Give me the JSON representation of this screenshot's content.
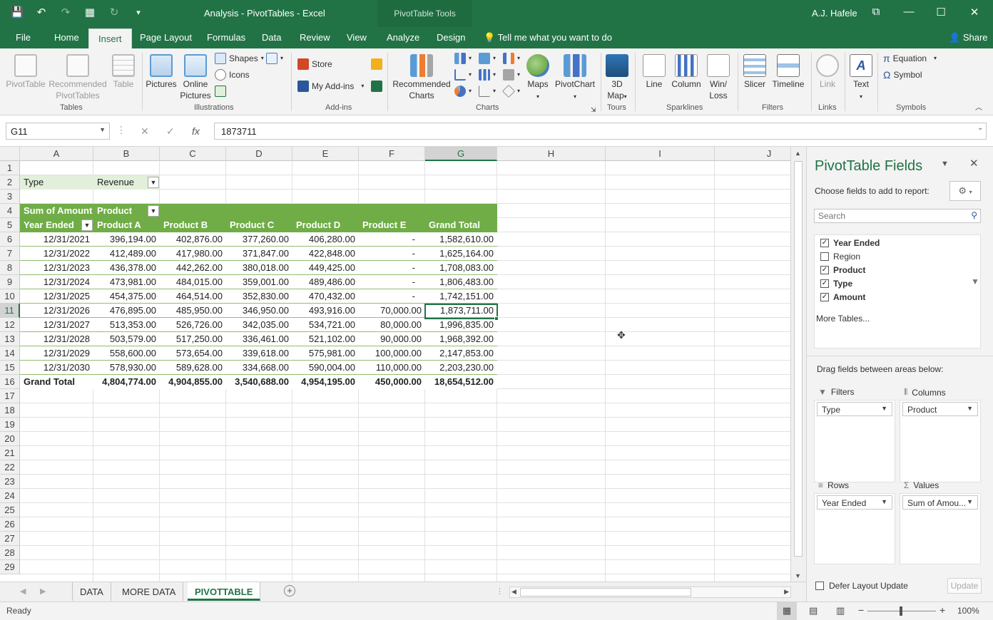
{
  "title": "Analysis - PivotTables  -  Excel",
  "context_tab_group": "PivotTable Tools",
  "user": "A.J. Hafele",
  "tabs": [
    "File",
    "Home",
    "Insert",
    "Page Layout",
    "Formulas",
    "Data",
    "Review",
    "View",
    "Analyze",
    "Design"
  ],
  "tell_me": "Tell me what you want to do",
  "share": "Share",
  "ribbon": {
    "tables": {
      "label": "Tables",
      "pivot": "PivotTable",
      "rec1": "Recommended",
      "rec2": "PivotTables",
      "table": "Table"
    },
    "illustrations": {
      "label": "Illustrations",
      "pictures": "Pictures",
      "online1": "Online",
      "online2": "Pictures",
      "shapes": "Shapes",
      "icons": "Icons"
    },
    "addins": {
      "label": "Add-ins",
      "store": "Store",
      "my": "My Add-ins"
    },
    "charts": {
      "label": "Charts",
      "rec1": "Recommended",
      "rec2": "Charts",
      "maps": "Maps",
      "pivotchart": "PivotChart"
    },
    "tours": {
      "label": "Tours",
      "map1": "3D",
      "map2": "Map"
    },
    "sparklines": {
      "label": "Sparklines",
      "line": "Line",
      "column": "Column",
      "win1": "Win/",
      "win2": "Loss"
    },
    "filters": {
      "label": "Filters",
      "slicer": "Slicer",
      "timeline": "Timeline"
    },
    "links": {
      "label": "Links",
      "link": "Link"
    },
    "text": {
      "text": "Text"
    },
    "symbols": {
      "label": "Symbols",
      "equation": "Equation",
      "symbol": "Symbol"
    }
  },
  "namebox": "G11",
  "formula": "1873711",
  "columns": [
    {
      "l": "A",
      "w": 103
    },
    {
      "l": "B",
      "w": 93
    },
    {
      "l": "C",
      "w": 93
    },
    {
      "l": "D",
      "w": 93
    },
    {
      "l": "E",
      "w": 93
    },
    {
      "l": "F",
      "w": 93
    },
    {
      "l": "G",
      "w": 101
    },
    {
      "l": "H",
      "w": 152
    },
    {
      "l": "I",
      "w": 153
    },
    {
      "l": "J",
      "w": 153
    }
  ],
  "rows": [
    "1",
    "2",
    "3",
    "4",
    "5",
    "6",
    "7",
    "8",
    "9",
    "10",
    "11",
    "12",
    "13",
    "14",
    "15",
    "16",
    "17",
    "18",
    "19",
    "20",
    "21",
    "22",
    "23",
    "24",
    "25",
    "26",
    "27",
    "28",
    "29"
  ],
  "pivot": {
    "filter_label": "Type",
    "filter_value": "Revenue",
    "corner": "Sum of Amount",
    "col_field": "Product",
    "row_field": "Year Ended",
    "col_headers": [
      "Product A",
      "Product B",
      "Product C",
      "Product D",
      "Product E",
      "Grand Total"
    ],
    "data": [
      [
        "12/31/2021",
        "396,194.00",
        "402,876.00",
        "377,260.00",
        "406,280.00",
        "-",
        "1,582,610.00"
      ],
      [
        "12/31/2022",
        "412,489.00",
        "417,980.00",
        "371,847.00",
        "422,848.00",
        "-",
        "1,625,164.00"
      ],
      [
        "12/31/2023",
        "436,378.00",
        "442,262.00",
        "380,018.00",
        "449,425.00",
        "-",
        "1,708,083.00"
      ],
      [
        "12/31/2024",
        "473,981.00",
        "484,015.00",
        "359,001.00",
        "489,486.00",
        "-",
        "1,806,483.00"
      ],
      [
        "12/31/2025",
        "454,375.00",
        "464,514.00",
        "352,830.00",
        "470,432.00",
        "-",
        "1,742,151.00"
      ],
      [
        "12/31/2026",
        "476,895.00",
        "485,950.00",
        "346,950.00",
        "493,916.00",
        "70,000.00",
        "1,873,711.00"
      ],
      [
        "12/31/2027",
        "513,353.00",
        "526,726.00",
        "342,035.00",
        "534,721.00",
        "80,000.00",
        "1,996,835.00"
      ],
      [
        "12/31/2028",
        "503,579.00",
        "517,250.00",
        "336,461.00",
        "521,102.00",
        "90,000.00",
        "1,968,392.00"
      ],
      [
        "12/31/2029",
        "558,600.00",
        "573,654.00",
        "339,618.00",
        "575,981.00",
        "100,000.00",
        "2,147,853.00"
      ],
      [
        "12/31/2030",
        "578,930.00",
        "589,628.00",
        "334,668.00",
        "590,004.00",
        "110,000.00",
        "2,203,230.00"
      ]
    ],
    "total": [
      "Grand Total",
      "4,804,774.00",
      "4,904,855.00",
      "3,540,688.00",
      "4,954,195.00",
      "450,000.00",
      "18,654,512.00"
    ]
  },
  "sheets": [
    "DATA",
    "MORE DATA",
    "PIVOTTABLE"
  ],
  "status": "Ready",
  "zoom": "100%",
  "pane": {
    "title": "PivotTable Fields",
    "choose": "Choose fields to add to report:",
    "search_placeholder": "Search",
    "fields": [
      {
        "name": "Year Ended",
        "checked": true
      },
      {
        "name": "Region",
        "checked": false
      },
      {
        "name": "Product",
        "checked": true
      },
      {
        "name": "Type",
        "checked": true
      },
      {
        "name": "Amount",
        "checked": true
      }
    ],
    "more_tables": "More Tables...",
    "drag_label": "Drag fields between areas below:",
    "areas": {
      "filters": {
        "label": "Filters",
        "value": "Type"
      },
      "columns": {
        "label": "Columns",
        "value": "Product"
      },
      "rows": {
        "label": "Rows",
        "value": "Year Ended"
      },
      "values": {
        "label": "Values",
        "value": "Sum of Amou..."
      }
    },
    "defer": "Defer Layout Update",
    "update": "Update"
  },
  "colors": {
    "accent": "#217346",
    "pivot_header": "#70ad47",
    "filter_fill": "#e2efda"
  }
}
